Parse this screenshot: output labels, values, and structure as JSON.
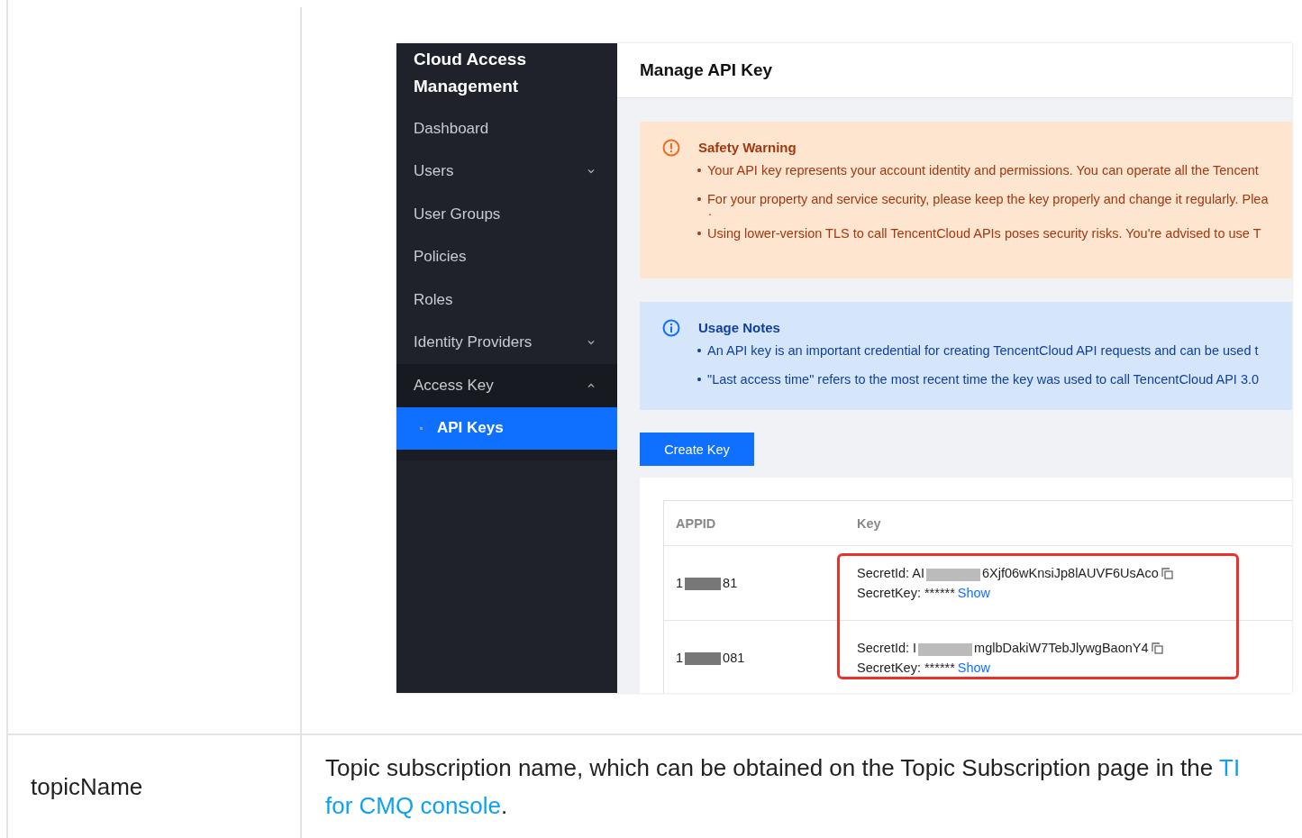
{
  "screenshot": {
    "sidebar": {
      "title": "Cloud Access Management",
      "items": [
        {
          "label": "Dashboard",
          "selected": false
        },
        {
          "label": "Users",
          "selected": false,
          "expanded": false
        },
        {
          "label": "User Groups",
          "selected": false
        },
        {
          "label": "Policies",
          "selected": false
        },
        {
          "label": "Roles",
          "selected": false
        },
        {
          "label": "Identity Providers",
          "selected": false,
          "expanded": false
        },
        {
          "label": "Access Key",
          "selected": false,
          "expanded": true,
          "children": [
            {
              "label": "API Keys",
              "selected": true
            }
          ]
        }
      ]
    },
    "header": {
      "title": "Manage API Key"
    },
    "alerts": [
      {
        "kind": "warning",
        "title": "Safety Warning",
        "lines": [
          "Your API key represents your account identity and permissions. You can operate all the Tencent",
          "For your property and service security, please keep the key properly and change it regularly. Plea",
          ".",
          "Using lower-version TLS to call TencentCloud APIs poses security risks. You're advised to use T"
        ]
      },
      {
        "kind": "info",
        "title": "Usage Notes",
        "lines": [
          "An API key is an important credential for creating TencentCloud API requests and can be used t",
          "\"Last access time\" refers to the most recent time the key was used to call TencentCloud API 3.0"
        ]
      }
    ],
    "create_button": "Create Key",
    "table": {
      "columns": [
        "APPID",
        "Key"
      ],
      "rows": [
        {
          "appid_start": "1",
          "appid_end": "81",
          "secret_id_label": "SecretId:",
          "secret_id_start": "AI",
          "secret_id_end": "6Xjf06wKnsiJp8lAUVF6UsAco",
          "secret_key_label": "SecretKey:",
          "secret_key": "******",
          "show_link": "Show"
        },
        {
          "appid_start": "1",
          "appid_end": "081",
          "secret_id_label": "SecretId:",
          "secret_id_start": "I",
          "secret_id_end": "mglbDakiW7TebJlywgBaonY4",
          "secret_key_label": "SecretKey:",
          "secret_key": "******",
          "show_link": "Show"
        }
      ]
    }
  },
  "param_row": {
    "name": "topicName",
    "description": "Topic subscription name, which can be obtained on the Topic Subscription page in the ",
    "link_start": "TI",
    "link_end": "for CMQ console",
    "description_end": "."
  }
}
